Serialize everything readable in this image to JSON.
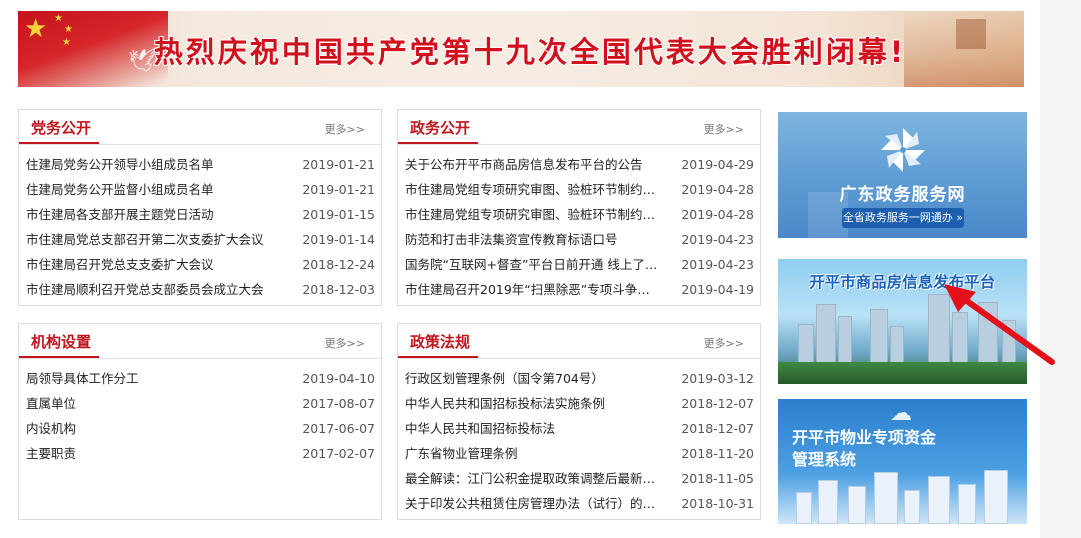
{
  "banner": {
    "title": "热烈庆祝中国共产党第十九次全国代表大会胜利闭幕!"
  },
  "panels": {
    "party_affairs": {
      "title": "党务公开",
      "more": "更多>>",
      "items": [
        {
          "text": "住建局党务公开领导小组成员名单",
          "date": "2019-01-21"
        },
        {
          "text": "住建局党务公开监督小组成员名单",
          "date": "2019-01-21"
        },
        {
          "text": "市住建局各支部开展主题党日活动",
          "date": "2019-01-15"
        },
        {
          "text": "市住建局党总支部召开第二次支委扩大会议",
          "date": "2019-01-14"
        },
        {
          "text": "市住建局召开党总支支委扩大会议",
          "date": "2018-12-24"
        },
        {
          "text": "市住建局顺利召开党总支部委员会成立大会",
          "date": "2018-12-03"
        }
      ]
    },
    "gov_affairs": {
      "title": "政务公开",
      "more": "更多>>",
      "items": [
        {
          "text": "关于公布开平市商品房信息发布平台的公告",
          "date": "2019-04-29"
        },
        {
          "text": "市住建局党组专项研究审图、验桩环节制约，…",
          "date": "2019-04-28"
        },
        {
          "text": "市住建局党组专项研究审图、验桩环节制约，…",
          "date": "2019-04-28"
        },
        {
          "text": "防范和打击非法集资宣传教育标语口号",
          "date": "2019-04-23"
        },
        {
          "text": "国务院“互联网+督查”平台日前开通 线上了…",
          "date": "2019-04-23"
        },
        {
          "text": "市住建局召开2019年“扫黑除恶”专项斗争…",
          "date": "2019-04-19"
        }
      ]
    },
    "institution": {
      "title": "机构设置",
      "more": "更多>>",
      "items": [
        {
          "text": "局领导具体工作分工",
          "date": "2019-04-10"
        },
        {
          "text": "直属单位",
          "date": "2017-08-07"
        },
        {
          "text": "内设机构",
          "date": "2017-06-07"
        },
        {
          "text": "主要职责",
          "date": "2017-02-07"
        }
      ]
    },
    "policy": {
      "title": "政策法规",
      "more": "更多>>",
      "items": [
        {
          "text": "行政区划管理条例（国令第704号）",
          "date": "2019-03-12"
        },
        {
          "text": "中华人民共和国招标投标法实施条例",
          "date": "2018-12-07"
        },
        {
          "text": "中华人民共和国招标投标法",
          "date": "2018-12-07"
        },
        {
          "text": "广东省物业管理条例",
          "date": "2018-11-20"
        },
        {
          "text": "最全解读：江门公积金提取政策调整后最新指…",
          "date": "2018-11-05"
        },
        {
          "text": "关于印发公共租赁住房管理办法（试行）的通…",
          "date": "2018-10-31"
        }
      ]
    }
  },
  "ads": {
    "gd_service": {
      "title": "广东政务服务网",
      "button": "全省政务服务一网通办 »"
    },
    "housing_platform": {
      "title": "开平市商品房信息发布平台"
    },
    "property_fund": {
      "title_line1": "开平市物业专项资金",
      "title_line2": "管理系统"
    }
  },
  "colors": {
    "accent": "#c0161e",
    "link": "#222222",
    "date": "#555555"
  }
}
